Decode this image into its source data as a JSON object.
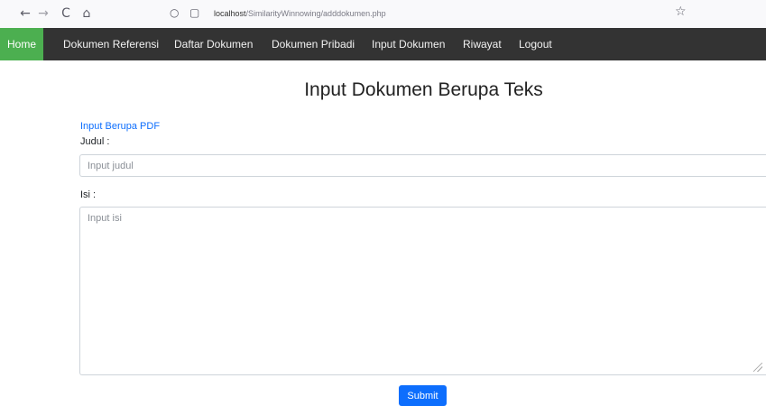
{
  "browser": {
    "back_icon": "←",
    "forward_icon": "→",
    "reload_icon": "C",
    "home_icon": "⌂",
    "shield_icon": "○",
    "page_icon": "▢",
    "url_host": "localhost",
    "url_path": "/SimilarityWinnowing/adddokumen.php",
    "bookmark_icon": "☆"
  },
  "navbar": {
    "items": [
      {
        "label": "Home",
        "active": true
      },
      {
        "label": "Dokumen Referensi"
      },
      {
        "label": "Daftar Dokumen"
      },
      {
        "label": "Dokumen Pribadi"
      },
      {
        "label": "Input Dokumen"
      },
      {
        "label": "Riwayat"
      },
      {
        "label": "Logout"
      }
    ],
    "bg_color": "#333333",
    "active_color": "#4caf50"
  },
  "main": {
    "title": "Input Dokumen Berupa Teks",
    "pdf_link": "Input Berupa PDF",
    "judul_label": "Judul :",
    "judul_placeholder": "Input judul",
    "isi_label": "Isi :",
    "isi_placeholder": "Input isi",
    "submit_label": "Submit",
    "submit_color": "#0d6efd"
  }
}
